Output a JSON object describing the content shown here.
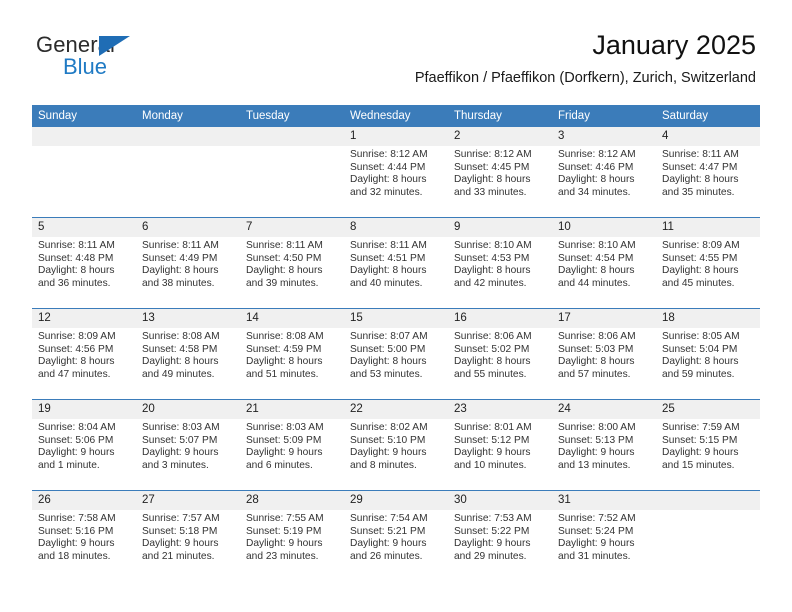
{
  "brand": {
    "name_top": "General",
    "name_bottom": "Blue",
    "color_blue": "#1f7ac4",
    "triangle_color": "#1f6db5",
    "triangle_icon": "triangle-flag-icon"
  },
  "header": {
    "title": "January 2025",
    "subtitle": "Pfaeffikon / Pfaeffikon (Dorfkern), Zurich, Switzerland"
  },
  "theme": {
    "header_blue": "#3b7cba",
    "daynum_band": "#f0f0f0",
    "cell_background": "#ffffff",
    "text": "#333333"
  },
  "weekdays": [
    "Sunday",
    "Monday",
    "Tuesday",
    "Wednesday",
    "Thursday",
    "Friday",
    "Saturday"
  ],
  "weeks": [
    [
      {
        "day": ""
      },
      {
        "day": ""
      },
      {
        "day": ""
      },
      {
        "day": "1",
        "sunrise": "Sunrise: 8:12 AM",
        "sunset": "Sunset: 4:44 PM",
        "daylight1": "Daylight: 8 hours",
        "daylight2": "and 32 minutes."
      },
      {
        "day": "2",
        "sunrise": "Sunrise: 8:12 AM",
        "sunset": "Sunset: 4:45 PM",
        "daylight1": "Daylight: 8 hours",
        "daylight2": "and 33 minutes."
      },
      {
        "day": "3",
        "sunrise": "Sunrise: 8:12 AM",
        "sunset": "Sunset: 4:46 PM",
        "daylight1": "Daylight: 8 hours",
        "daylight2": "and 34 minutes."
      },
      {
        "day": "4",
        "sunrise": "Sunrise: 8:11 AM",
        "sunset": "Sunset: 4:47 PM",
        "daylight1": "Daylight: 8 hours",
        "daylight2": "and 35 minutes."
      }
    ],
    [
      {
        "day": "5",
        "sunrise": "Sunrise: 8:11 AM",
        "sunset": "Sunset: 4:48 PM",
        "daylight1": "Daylight: 8 hours",
        "daylight2": "and 36 minutes."
      },
      {
        "day": "6",
        "sunrise": "Sunrise: 8:11 AM",
        "sunset": "Sunset: 4:49 PM",
        "daylight1": "Daylight: 8 hours",
        "daylight2": "and 38 minutes."
      },
      {
        "day": "7",
        "sunrise": "Sunrise: 8:11 AM",
        "sunset": "Sunset: 4:50 PM",
        "daylight1": "Daylight: 8 hours",
        "daylight2": "and 39 minutes."
      },
      {
        "day": "8",
        "sunrise": "Sunrise: 8:11 AM",
        "sunset": "Sunset: 4:51 PM",
        "daylight1": "Daylight: 8 hours",
        "daylight2": "and 40 minutes."
      },
      {
        "day": "9",
        "sunrise": "Sunrise: 8:10 AM",
        "sunset": "Sunset: 4:53 PM",
        "daylight1": "Daylight: 8 hours",
        "daylight2": "and 42 minutes."
      },
      {
        "day": "10",
        "sunrise": "Sunrise: 8:10 AM",
        "sunset": "Sunset: 4:54 PM",
        "daylight1": "Daylight: 8 hours",
        "daylight2": "and 44 minutes."
      },
      {
        "day": "11",
        "sunrise": "Sunrise: 8:09 AM",
        "sunset": "Sunset: 4:55 PM",
        "daylight1": "Daylight: 8 hours",
        "daylight2": "and 45 minutes."
      }
    ],
    [
      {
        "day": "12",
        "sunrise": "Sunrise: 8:09 AM",
        "sunset": "Sunset: 4:56 PM",
        "daylight1": "Daylight: 8 hours",
        "daylight2": "and 47 minutes."
      },
      {
        "day": "13",
        "sunrise": "Sunrise: 8:08 AM",
        "sunset": "Sunset: 4:58 PM",
        "daylight1": "Daylight: 8 hours",
        "daylight2": "and 49 minutes."
      },
      {
        "day": "14",
        "sunrise": "Sunrise: 8:08 AM",
        "sunset": "Sunset: 4:59 PM",
        "daylight1": "Daylight: 8 hours",
        "daylight2": "and 51 minutes."
      },
      {
        "day": "15",
        "sunrise": "Sunrise: 8:07 AM",
        "sunset": "Sunset: 5:00 PM",
        "daylight1": "Daylight: 8 hours",
        "daylight2": "and 53 minutes."
      },
      {
        "day": "16",
        "sunrise": "Sunrise: 8:06 AM",
        "sunset": "Sunset: 5:02 PM",
        "daylight1": "Daylight: 8 hours",
        "daylight2": "and 55 minutes."
      },
      {
        "day": "17",
        "sunrise": "Sunrise: 8:06 AM",
        "sunset": "Sunset: 5:03 PM",
        "daylight1": "Daylight: 8 hours",
        "daylight2": "and 57 minutes."
      },
      {
        "day": "18",
        "sunrise": "Sunrise: 8:05 AM",
        "sunset": "Sunset: 5:04 PM",
        "daylight1": "Daylight: 8 hours",
        "daylight2": "and 59 minutes."
      }
    ],
    [
      {
        "day": "19",
        "sunrise": "Sunrise: 8:04 AM",
        "sunset": "Sunset: 5:06 PM",
        "daylight1": "Daylight: 9 hours",
        "daylight2": "and 1 minute."
      },
      {
        "day": "20",
        "sunrise": "Sunrise: 8:03 AM",
        "sunset": "Sunset: 5:07 PM",
        "daylight1": "Daylight: 9 hours",
        "daylight2": "and 3 minutes."
      },
      {
        "day": "21",
        "sunrise": "Sunrise: 8:03 AM",
        "sunset": "Sunset: 5:09 PM",
        "daylight1": "Daylight: 9 hours",
        "daylight2": "and 6 minutes."
      },
      {
        "day": "22",
        "sunrise": "Sunrise: 8:02 AM",
        "sunset": "Sunset: 5:10 PM",
        "daylight1": "Daylight: 9 hours",
        "daylight2": "and 8 minutes."
      },
      {
        "day": "23",
        "sunrise": "Sunrise: 8:01 AM",
        "sunset": "Sunset: 5:12 PM",
        "daylight1": "Daylight: 9 hours",
        "daylight2": "and 10 minutes."
      },
      {
        "day": "24",
        "sunrise": "Sunrise: 8:00 AM",
        "sunset": "Sunset: 5:13 PM",
        "daylight1": "Daylight: 9 hours",
        "daylight2": "and 13 minutes."
      },
      {
        "day": "25",
        "sunrise": "Sunrise: 7:59 AM",
        "sunset": "Sunset: 5:15 PM",
        "daylight1": "Daylight: 9 hours",
        "daylight2": "and 15 minutes."
      }
    ],
    [
      {
        "day": "26",
        "sunrise": "Sunrise: 7:58 AM",
        "sunset": "Sunset: 5:16 PM",
        "daylight1": "Daylight: 9 hours",
        "daylight2": "and 18 minutes."
      },
      {
        "day": "27",
        "sunrise": "Sunrise: 7:57 AM",
        "sunset": "Sunset: 5:18 PM",
        "daylight1": "Daylight: 9 hours",
        "daylight2": "and 21 minutes."
      },
      {
        "day": "28",
        "sunrise": "Sunrise: 7:55 AM",
        "sunset": "Sunset: 5:19 PM",
        "daylight1": "Daylight: 9 hours",
        "daylight2": "and 23 minutes."
      },
      {
        "day": "29",
        "sunrise": "Sunrise: 7:54 AM",
        "sunset": "Sunset: 5:21 PM",
        "daylight1": "Daylight: 9 hours",
        "daylight2": "and 26 minutes."
      },
      {
        "day": "30",
        "sunrise": "Sunrise: 7:53 AM",
        "sunset": "Sunset: 5:22 PM",
        "daylight1": "Daylight: 9 hours",
        "daylight2": "and 29 minutes."
      },
      {
        "day": "31",
        "sunrise": "Sunrise: 7:52 AM",
        "sunset": "Sunset: 5:24 PM",
        "daylight1": "Daylight: 9 hours",
        "daylight2": "and 31 minutes."
      },
      {
        "day": ""
      }
    ]
  ]
}
